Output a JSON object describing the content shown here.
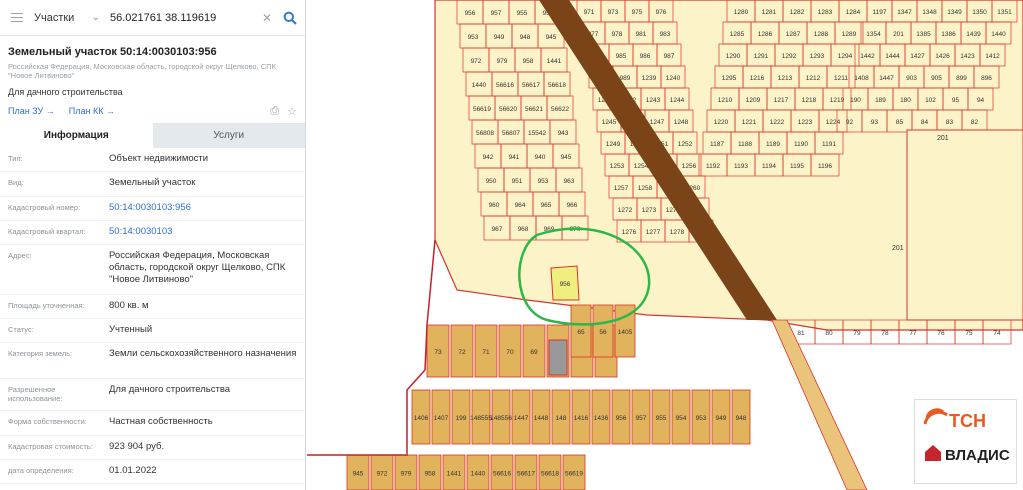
{
  "search": {
    "layer": "Участки",
    "query": "56.021761 38.119619",
    "menu_icon": "hamburger-icon",
    "search_icon": "magnifier-icon"
  },
  "parcel": {
    "title": "Земельный участок 50:14:0030103:956",
    "address_line": "Российская Федерация, Московская область, городской округ Щелково, СПК \"Новое Литвиново\"",
    "usage": "Для дачного строительства",
    "plan_zu": "План ЗУ →",
    "plan_kk": "План КК →"
  },
  "tabs": {
    "info": "Информация",
    "services": "Услуги"
  },
  "info_rows": [
    {
      "key": "Тип:",
      "value": "Объект недвижимости"
    },
    {
      "key": "Вид:",
      "value": "Земельный участок"
    },
    {
      "key": "Кадастровый номер:",
      "value": "50:14:0030103:956"
    },
    {
      "key": "Кадастровый квартал:",
      "value": "50:14:0030103"
    },
    {
      "key": "Адрес:",
      "value": "Российская Федерация, Московская область, городской округ Щелково, СПК \"Новое Литвиново\""
    },
    {
      "key": "Площадь уточненная:",
      "value": "800 кв. м"
    },
    {
      "key": "Статус:",
      "value": "Учтенный"
    },
    {
      "key": "Категория земель:",
      "value": "Земли сельскохозяйственного назначения"
    },
    {
      "key": "Разрешенное использование:",
      "value": "Для дачного строительства"
    },
    {
      "key": "Форма собственности:",
      "value": "Частная собственность"
    },
    {
      "key": "Кадастровая стоимость:",
      "value": "923 904 руб."
    },
    {
      "key": "дата определения:",
      "value": "01.01.2022"
    }
  ],
  "map": {
    "parcel_labels": [
      "956",
      "957",
      "955",
      "954",
      "953",
      "949",
      "948",
      "945",
      "972",
      "979",
      "958",
      "1441",
      "1440",
      "56616",
      "56617",
      "56618",
      "56619",
      "56620",
      "56621",
      "56622",
      "56808",
      "56807",
      "15542",
      "943",
      "942",
      "941",
      "940",
      "945",
      "950",
      "951",
      "953",
      "963",
      "960",
      "964",
      "965",
      "966",
      "967",
      "968",
      "969",
      "970",
      "971",
      "973",
      "975",
      "976",
      "977",
      "978",
      "981",
      "983",
      "984",
      "985",
      "986",
      "987",
      "988",
      "989",
      "1239",
      "1240",
      "1241",
      "1242",
      "1243",
      "1244",
      "1245",
      "1246",
      "1247",
      "1248",
      "1249",
      "1250",
      "1251",
      "1252",
      "1253",
      "1254",
      "1255",
      "1256",
      "1257",
      "1258",
      "1259",
      "1260",
      "1272",
      "1273",
      "1274",
      "1275",
      "1276",
      "1277",
      "1278",
      "1279",
      "1280",
      "1281",
      "1282",
      "1283",
      "1284",
      "1285",
      "1286",
      "1287",
      "1288",
      "1289",
      "1290",
      "1291",
      "1292",
      "1293",
      "1294",
      "1295",
      "1216",
      "1213",
      "1212",
      "1211",
      "1210",
      "1209",
      "1217",
      "1218",
      "1219",
      "1220",
      "1221",
      "1222",
      "1223",
      "1224",
      "1187",
      "1188",
      "1189",
      "1190",
      "1191",
      "1192",
      "1193",
      "1194",
      "1195",
      "1196",
      "1197",
      "1347",
      "1348",
      "1349",
      "1350",
      "1351",
      "1354",
      "201",
      "1385",
      "1386",
      "1439",
      "1440",
      "1442",
      "1444",
      "1427",
      "1426",
      "1423",
      "1412",
      "1408",
      "1447",
      "903",
      "905",
      "899",
      "896",
      "190",
      "189",
      "180",
      "102",
      "95",
      "94",
      "92",
      "93",
      "85",
      "84",
      "83",
      "82",
      "81",
      "80",
      "79",
      "78",
      "77",
      "76",
      "75",
      "74",
      "73",
      "72",
      "71",
      "70",
      "69",
      "68",
      "67",
      "66",
      "65",
      "56",
      "1405",
      "1406",
      "1407",
      "199",
      "148555",
      "148556",
      "1447",
      "1448",
      "148",
      "1416",
      "1436"
    ],
    "highlight_color": "#f0ee7e",
    "parcel_fill": "#fcf4c8",
    "parcel_border": "#d9332c",
    "plot_fill": "#e0b35c",
    "road_color": "#7a4418",
    "circle_color": "#2bb848"
  },
  "logo": {
    "line1": "ТСН",
    "line2": "ВЛАДИС"
  }
}
